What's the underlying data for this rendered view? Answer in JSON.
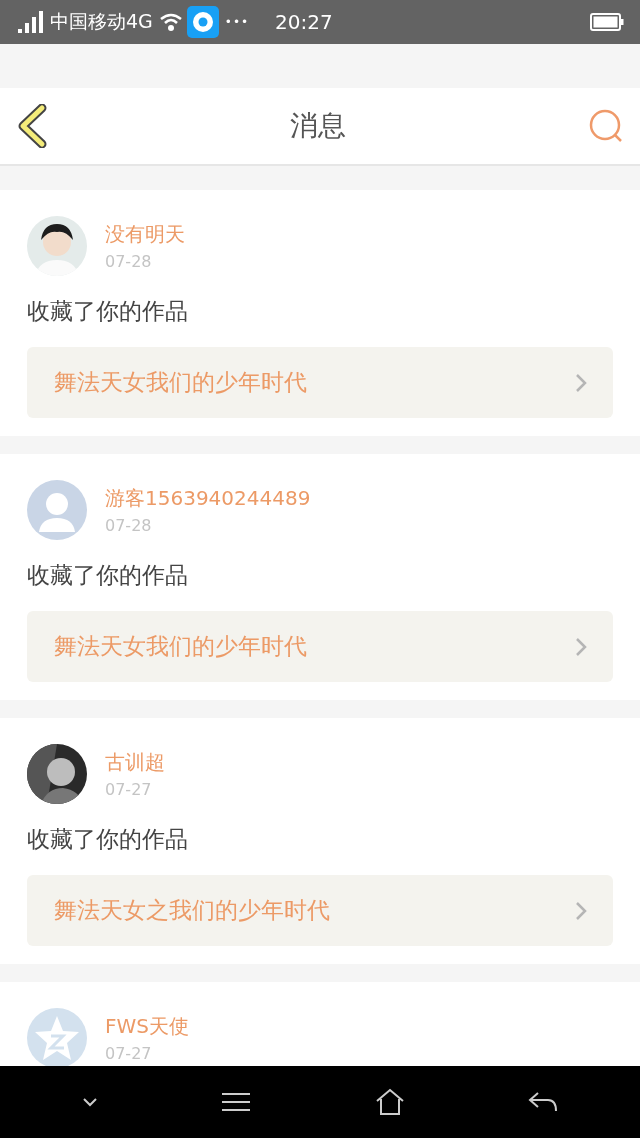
{
  "status_bar": {
    "carrier": "中国移动4G",
    "dots": "•••",
    "time": "20:27"
  },
  "header": {
    "title": "消息"
  },
  "messages": [
    {
      "name": "没有明天",
      "date": "07-28",
      "action": "收藏了你的作品",
      "work": "舞法天女我们的少年时代"
    },
    {
      "avatar": {
        "kind": "default"
      },
      "name": "游客1563940244489",
      "date": "07-28",
      "action": "收藏了你的作品",
      "work": "舞法天女我们的少年时代"
    },
    {
      "avatar": {
        "kind": "photo_dark"
      },
      "name": "古训超",
      "date": "07-27",
      "action": "收藏了你的作品",
      "work": "舞法天女之我们的少年时代"
    },
    {
      "avatar": {
        "kind": "star"
      },
      "name": "FWS天使",
      "date": "07-27"
    }
  ]
}
